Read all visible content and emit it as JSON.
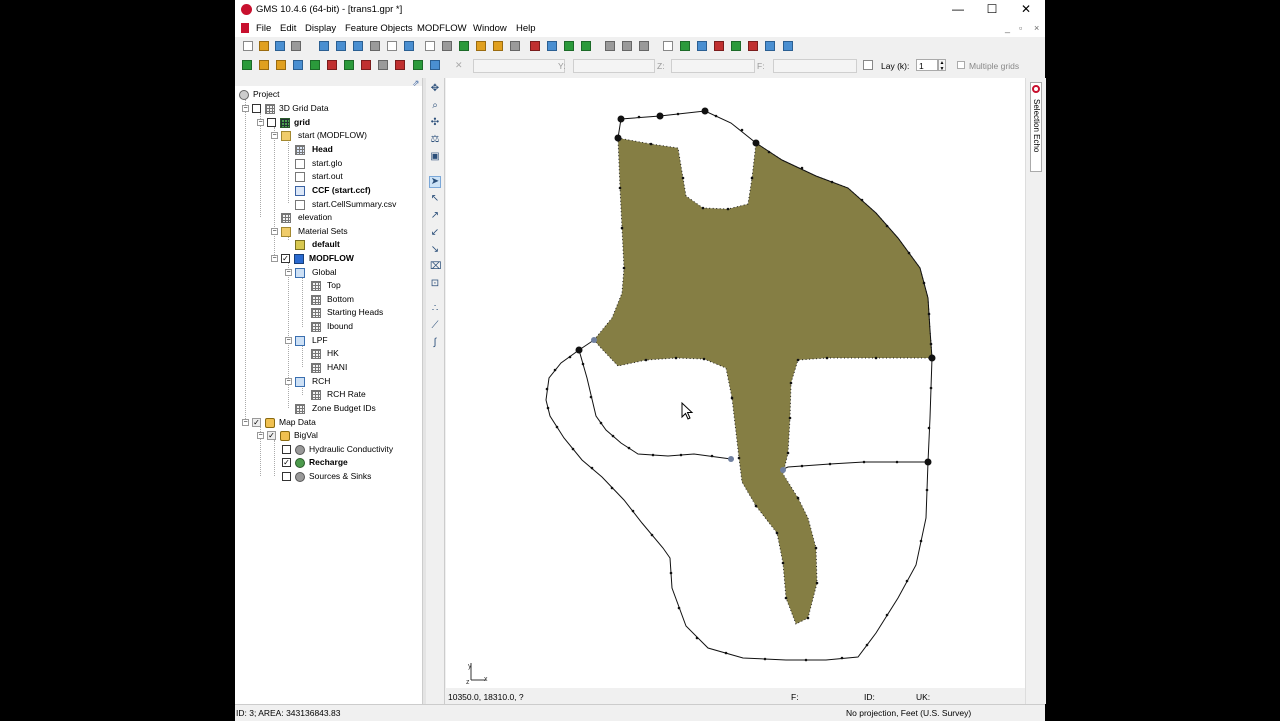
{
  "window": {
    "title": "GMS 10.4.6 (64-bit) - [trans1.gpr *]"
  },
  "window_buttons": {
    "minimize": "—",
    "maximize": "☐",
    "close": "✕"
  },
  "menu": [
    "File",
    "Edit",
    "Display",
    "Feature Objects",
    "MODFLOW",
    "Window",
    "Help"
  ],
  "mdi_buttons": [
    "_",
    "▫",
    "×"
  ],
  "toolbar2": {
    "y_label": "Y:",
    "z_label": "Z:",
    "f_label": "F:",
    "lay_label": "Lay (k):",
    "lay_value": "1",
    "multiple_grids": "Multiple grids"
  },
  "tree": {
    "project": "Project",
    "grid_data": "3D Grid Data",
    "grid": "grid",
    "start": "start (MODFLOW)",
    "head": "Head",
    "start_glo": "start.glo",
    "start_out": "start.out",
    "ccf": "CCF (start.ccf)",
    "cellsummary": "start.CellSummary.csv",
    "elevation": "elevation",
    "material_sets": "Material Sets",
    "default": "default",
    "modflow": "MODFLOW",
    "global": "Global",
    "top": "Top",
    "bottom": "Bottom",
    "starting_heads": "Starting Heads",
    "ibound": "Ibound",
    "lpf": "LPF",
    "hk": "HK",
    "hani": "HANI",
    "rch": "RCH",
    "rch_rate": "RCH Rate",
    "zone_budget": "Zone Budget IDs",
    "map_data": "Map Data",
    "bigval": "BigVal",
    "hydraulic_cond": "Hydraulic Conductivity",
    "recharge": "Recharge",
    "sources_sinks": "Sources & Sinks"
  },
  "selection_echo": "Selection Echo",
  "canvas_status": {
    "coords": "10350.0, 18310.0, ?",
    "f": "F:",
    "id": "ID:",
    "uk": "UK:"
  },
  "status": {
    "left": "ID: 3; AREA: 343136843.83",
    "right": "No projection, Feet (U.S. Survey)"
  },
  "colors": {
    "polygon_fill": "#857e44",
    "selection_echo_accent": "#c8102e"
  }
}
